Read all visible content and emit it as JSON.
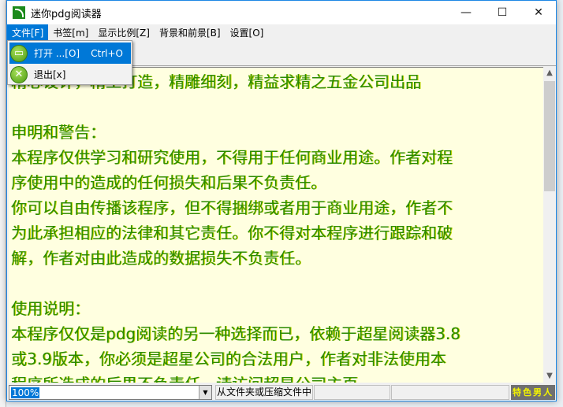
{
  "window": {
    "title": "迷你pdg阅读器",
    "minimize": "—",
    "maximize": "☐",
    "close": "✕"
  },
  "menubar": [
    "文件[F]",
    "书签[m]",
    "显示比例[Z]",
    "背景和前景[B]",
    "设置[O]"
  ],
  "file_menu": {
    "items": [
      {
        "label": "打开 ...[O]",
        "shortcut": "Ctrl+O",
        "icon": "folder-open-icon"
      },
      {
        "label": "退出[x]",
        "icon": "exit-icon"
      }
    ]
  },
  "content": {
    "lines": [
      "精心设计，精工打造，精雕细刻，精益求精之五金公司出品",
      "",
      "申明和警告：",
      "本程序仅供学习和研究使用，不得用于任何商业用途。作者对程",
      "序使用中的造成的任何损失和后果不负责任。",
      "你可以自由传播该程序，但不得捆绑或者用于商业用途，作者不",
      "为此承担相应的法律和其它责任。你不得对本程序进行跟踪和破",
      "解，作者对由此造成的数据损失不负责任。",
      "",
      "使用说明：",
      "本程序仅仅是pdg阅读的另一种选择而已，依赖于超星阅读器3.8",
      "或3.9版本，你必须是超星公司的合法用户，作者对非法使用本",
      "程序所造成的后果不负责任，请访问超星公司主页"
    ]
  },
  "status": {
    "zoom": "100%",
    "source": "从文件夹或压缩文件中",
    "panel2": "",
    "panel3": "",
    "badge": "特色男人"
  },
  "colors": {
    "text": "#2a8a00",
    "background": "#ffffe0",
    "accent": "#0078d7"
  }
}
